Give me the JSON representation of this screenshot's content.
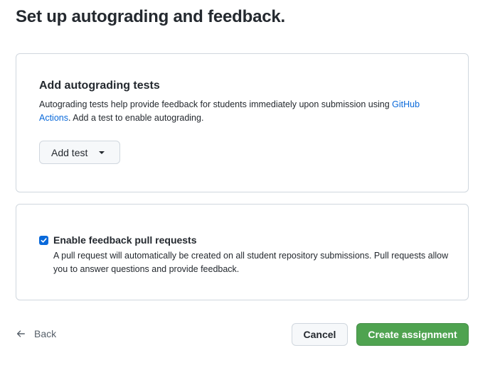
{
  "page": {
    "title": "Set up autograding and feedback."
  },
  "autograding": {
    "title": "Add autograding tests",
    "description_before_link": "Autograding tests help provide feedback for students immediately upon submission using ",
    "link_text": "GitHub Actions",
    "description_after_link": ". Add a test to enable autograding.",
    "add_test_label": "Add test"
  },
  "feedback": {
    "checkbox_checked": true,
    "title": "Enable feedback pull requests",
    "description": "A pull request will automatically be created on all student repository submissions. Pull requests allow you to answer questions and provide feedback."
  },
  "footer": {
    "back_label": "Back",
    "cancel_label": "Cancel",
    "create_label": "Create assignment"
  },
  "colors": {
    "accent": "#0969da",
    "primary_button": "#4fa350",
    "border": "#d0d7de"
  }
}
